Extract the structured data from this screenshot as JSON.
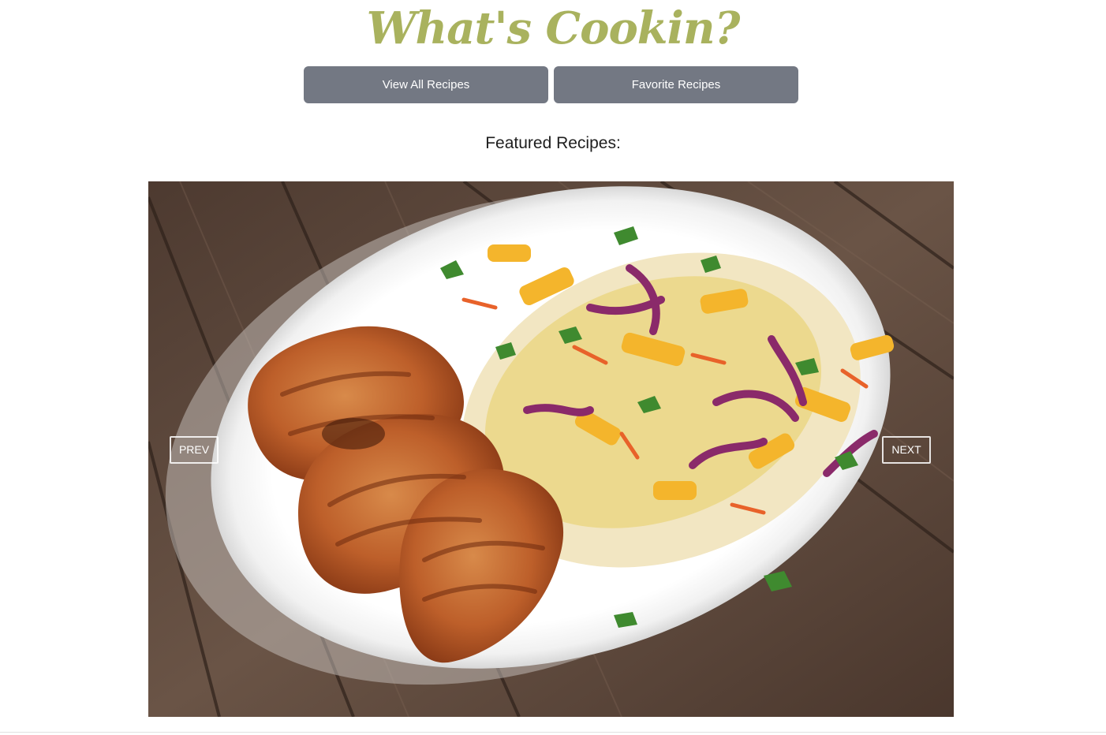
{
  "header": {
    "title": "What's Cookin?"
  },
  "nav": {
    "view_all_label": "View All Recipes",
    "favorites_label": "Favorite Recipes"
  },
  "featured": {
    "heading": "Featured Recipes:",
    "carousel": {
      "prev_label": "PREV",
      "next_label": "NEXT",
      "image_alt": "Grilled chicken with pineapple slaw on a white plate"
    }
  },
  "colors": {
    "title": "#a9b25e",
    "button_bg": "#737883",
    "button_text": "#ffffff"
  }
}
